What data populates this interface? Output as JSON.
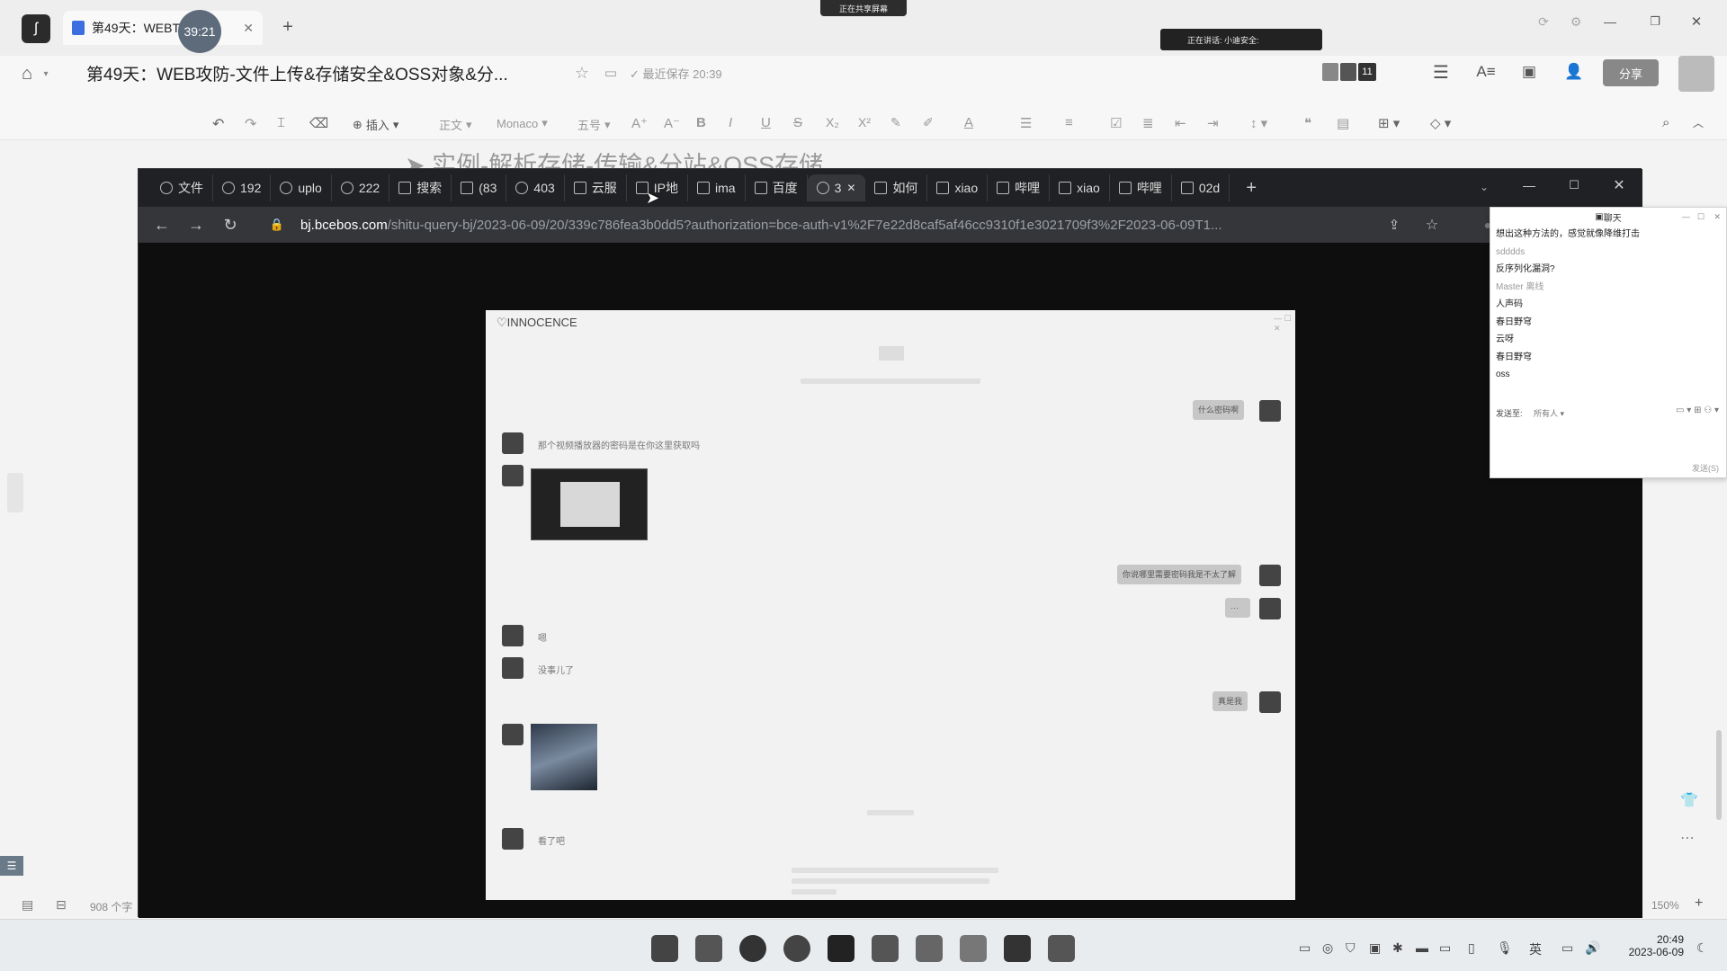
{
  "app": {
    "doc_tab_title": "第49天：WEBT",
    "recording_time": "39:21",
    "doc_title": "第49天：WEB攻防-文件上传&存储安全&OSS对象&分...",
    "save_status": "最近保存 20:39",
    "screen_share_notice": "正在共享屏幕",
    "speaking_notice": "正在讲话: 小迪安全:",
    "participants_count": "11",
    "share_button": "分享",
    "heading_partial": "实例-解析存储-传输&分站&OSS存储",
    "word_count": "908 个字",
    "zoom": "150%"
  },
  "toolbar": {
    "insert": "插入",
    "style": "正文",
    "font": "Monaco",
    "size": "五号"
  },
  "browser": {
    "tabs": [
      {
        "label": "文件",
        "icon": "globe-icon"
      },
      {
        "label": "192",
        "icon": "globe-icon"
      },
      {
        "label": "uplo",
        "icon": "globe-icon"
      },
      {
        "label": "222",
        "icon": "globe-icon"
      },
      {
        "label": "搜索",
        "icon": "search-app-icon"
      },
      {
        "label": "(83",
        "icon": "app-icon"
      },
      {
        "label": "403",
        "icon": "globe-icon"
      },
      {
        "label": "云服",
        "icon": "cloud-icon"
      },
      {
        "label": "IP地",
        "icon": "app-icon"
      },
      {
        "label": "ima",
        "icon": "image-icon"
      },
      {
        "label": "百度",
        "icon": "app-icon"
      },
      {
        "label": "3",
        "icon": "globe-icon",
        "active": true
      },
      {
        "label": "如何",
        "icon": "tv-icon"
      },
      {
        "label": "xiao",
        "icon": "tv-icon"
      },
      {
        "label": "哔哩",
        "icon": "tv-icon"
      },
      {
        "label": "xiao",
        "icon": "tv-icon"
      },
      {
        "label": "哔哩",
        "icon": "tv-icon"
      },
      {
        "label": "02d",
        "icon": "tv-icon"
      }
    ],
    "url_domain": "bj.bcebos.com",
    "url_path": "/shitu-query-bj/2023-06-09/20/339c786fea3b0dd5?authorization=bce-auth-v1%2F7e22d8caf5af46cc9310f1e3021709f3%2F2023-06-09T1..."
  },
  "image_content": {
    "app_title": "INNOCENCE",
    "left_messages": [
      "那个视频播放器的密码是在你这里获取吗",
      "嗯",
      "没事儿了",
      "看了吧"
    ],
    "right_messages": [
      "什么密码啊",
      "你说哪里需要密码我是不太了解",
      "…",
      "真是我"
    ]
  },
  "chat_popup": {
    "title": "聊天",
    "messages": [
      {
        "text": "想出这种方法的，感觉就像降维打击",
        "dim": false
      },
      {
        "text": "sdddds",
        "dim": true
      },
      {
        "text": "反序列化漏洞?",
        "dim": false
      },
      {
        "text": "Master 离线",
        "dim": true
      },
      {
        "text": "人声码",
        "dim": false
      },
      {
        "text": "春日野穹",
        "dim": false
      },
      {
        "text": "云呀",
        "dim": false
      },
      {
        "text": "春日野穹",
        "dim": false
      },
      {
        "text": "oss",
        "dim": false
      }
    ],
    "send_to_label": "发送至:",
    "send_to_value": "所有人",
    "send_button": "发送(S)"
  },
  "taskbar": {
    "ime": "英",
    "time": "20:49",
    "date": "2023-06-09"
  }
}
